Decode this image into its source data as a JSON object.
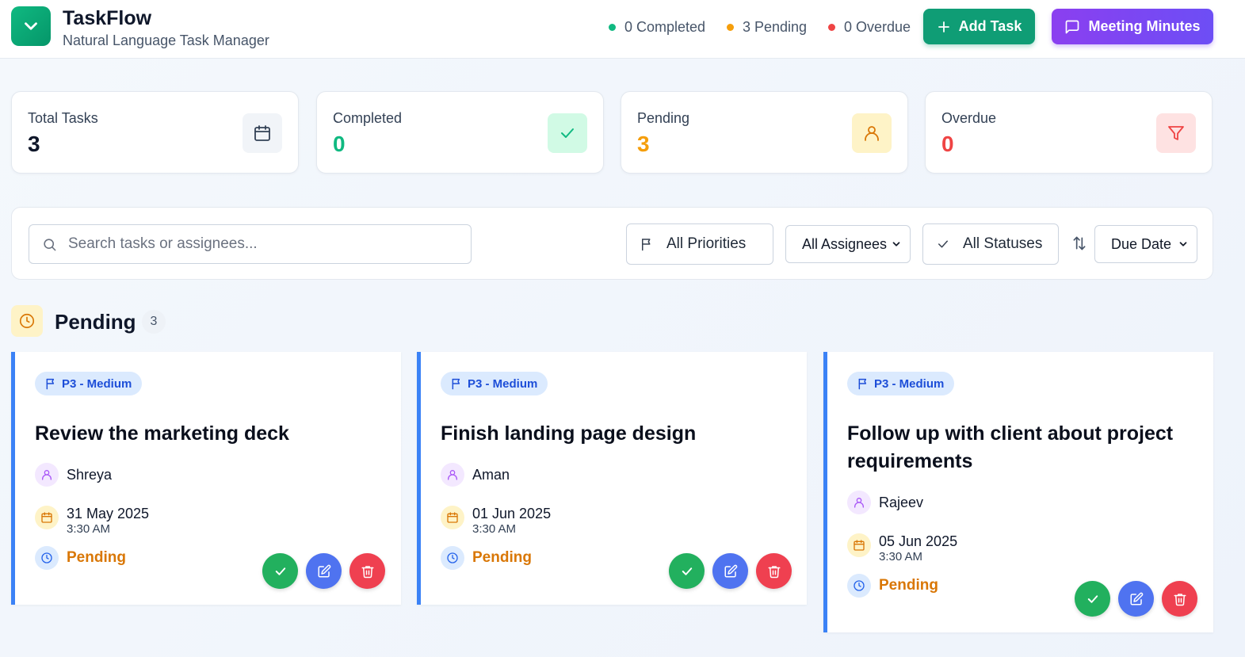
{
  "app": {
    "title": "TaskFlow",
    "subtitle": "Natural Language Task Manager"
  },
  "header_stats": [
    {
      "label": "0 Completed",
      "color": "#10b981"
    },
    {
      "label": "3 Pending",
      "color": "#f59e0b"
    },
    {
      "label": "0 Overdue",
      "color": "#ef4444"
    }
  ],
  "buttons": {
    "add_task": "Add Task",
    "meeting_minutes": "Meeting Minutes"
  },
  "stats": [
    {
      "label": "Total Tasks",
      "value": "3",
      "color": "#0f172a",
      "icon": "calendar-icon"
    },
    {
      "label": "Completed",
      "value": "0",
      "color": "#10b981",
      "icon": "check-icon"
    },
    {
      "label": "Pending",
      "value": "3",
      "color": "#f59e0b",
      "icon": "user-icon"
    },
    {
      "label": "Overdue",
      "value": "0",
      "color": "#ef4444",
      "icon": "filter-icon"
    }
  ],
  "filters": {
    "search_placeholder": "Search tasks or assignees...",
    "priority": "All Priorities",
    "assignee": "All Assignees",
    "status": "All Statuses",
    "sort": "Due Date"
  },
  "section": {
    "title": "Pending",
    "count": "3"
  },
  "tasks": [
    {
      "priority": "P3 - Medium",
      "title": "Review the marketing deck",
      "assignee": "Shreya",
      "date": "31 May 2025",
      "time": "3:30 AM",
      "status": "Pending"
    },
    {
      "priority": "P3 - Medium",
      "title": "Finish landing page design",
      "assignee": "Aman",
      "date": "01 Jun 2025",
      "time": "3:30 AM",
      "status": "Pending"
    },
    {
      "priority": "P3 - Medium",
      "title": "Follow up with client about project requirements",
      "assignee": "Rajeev",
      "date": "05 Jun 2025",
      "time": "3:30 AM",
      "status": "Pending"
    }
  ]
}
